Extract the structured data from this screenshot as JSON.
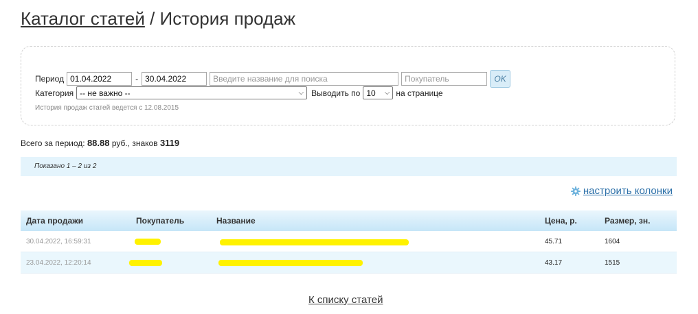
{
  "header": {
    "catalog_link": "Каталог статей",
    "separator": " / ",
    "title": "История продаж"
  },
  "filter": {
    "period_label": "Период",
    "date_from": "01.04.2022",
    "date_dash": "-",
    "date_to": "30.04.2022",
    "search_placeholder": "Введите название для поиска",
    "buyer_placeholder": "Покупатель",
    "ok_label": "OK",
    "category_label": "Категория",
    "category_value": "-- не важно --",
    "per_page_label": "Выводить по",
    "per_page_value": "10",
    "per_page_suffix": "на странице",
    "note": "История продаж статей ведется с 12.08.2015"
  },
  "totals": {
    "prefix": "Всего за период: ",
    "amount": "88.88",
    "currency": " руб., знаков ",
    "chars": "3119"
  },
  "shown": "Показано 1 – 2 из 2",
  "columns_link": "настроить колонки",
  "table": {
    "headers": [
      "Дата продажи",
      "Покупатель",
      "Название",
      "Цена, р.",
      "Размер, зн."
    ],
    "rows": [
      {
        "date": "30.04.2022, 16:59:31",
        "buyer": "",
        "title": "",
        "price": "45.71",
        "size": "1604"
      },
      {
        "date": "23.04.2022, 12:20:14",
        "buyer": "",
        "title": "",
        "price": "43.17",
        "size": "1515"
      }
    ]
  },
  "bottom_link": "К списку статей",
  "colors": {
    "link": "#2b6fa8",
    "header_gradient_top": "#eaf6fd",
    "header_gradient_bottom": "#c6e6f8",
    "highlight_marker": "#fff200"
  }
}
